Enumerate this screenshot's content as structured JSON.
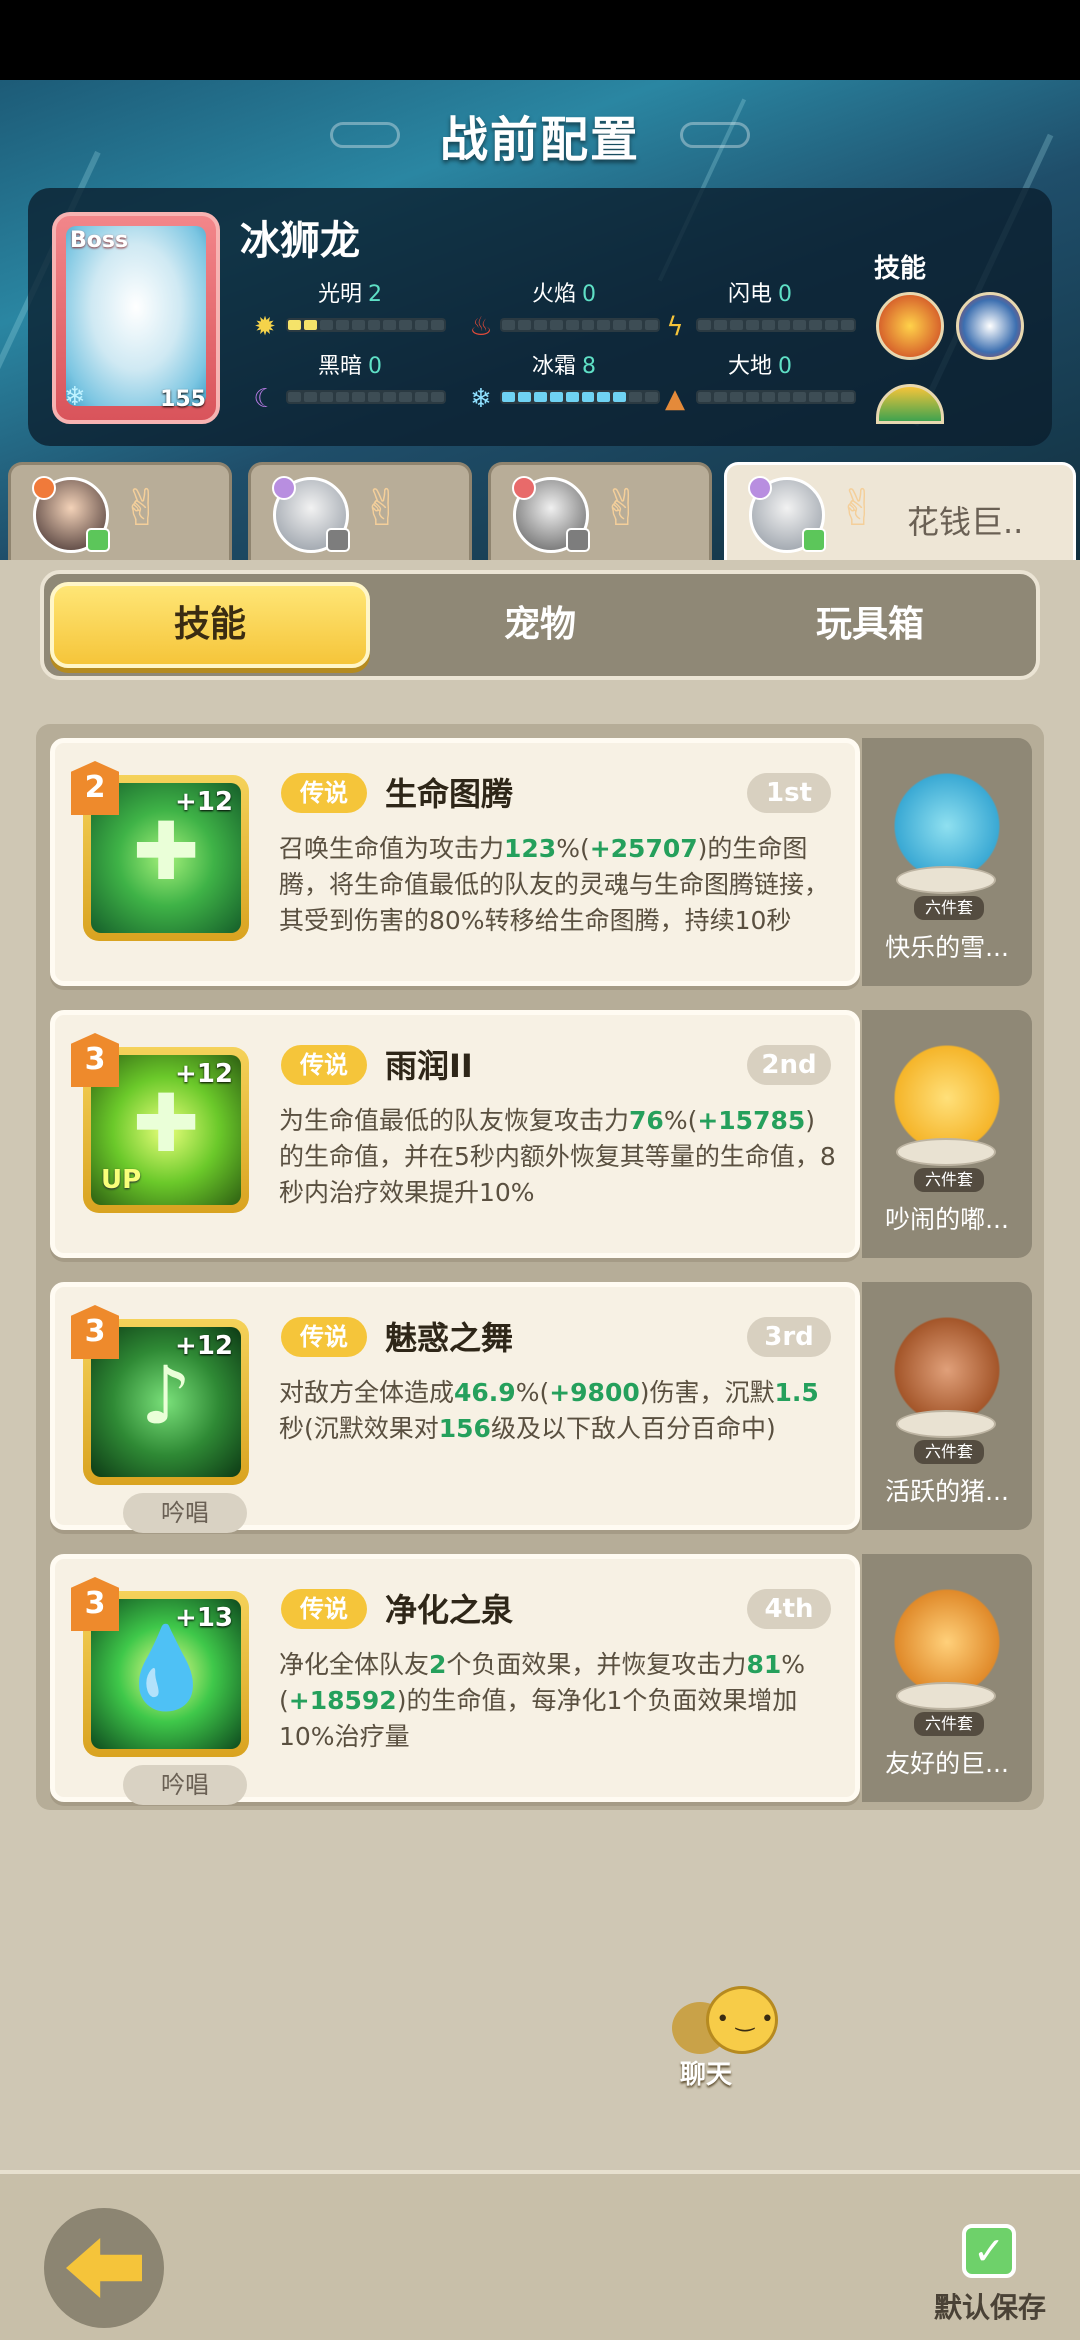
{
  "header": {
    "title": "战前配置"
  },
  "boss": {
    "tag": "Boss",
    "level": "155",
    "name": "冰狮龙",
    "skills_label": "技能",
    "elements": [
      {
        "name": "光明",
        "value": "2",
        "level": 2
      },
      {
        "name": "火焰",
        "value": "0",
        "level": 0
      },
      {
        "name": "闪电",
        "value": "0",
        "level": 0
      },
      {
        "name": "黑暗",
        "value": "0",
        "level": 0
      },
      {
        "name": "冰霜",
        "value": "8",
        "level": 8
      },
      {
        "name": "大地",
        "value": "0",
        "level": 0
      }
    ]
  },
  "hero_tabs": [
    {
      "label": ""
    },
    {
      "label": ""
    },
    {
      "label": ""
    },
    {
      "label": "花钱巨.."
    }
  ],
  "segments": {
    "skills": "技能",
    "pets": "宠物",
    "toybox": "玩具箱"
  },
  "skills": [
    {
      "rank": "2",
      "plus": "+12",
      "rarity": "传说",
      "title": "生命图腾",
      "order": "1st",
      "desc": {
        "p1": "召唤生命值为攻击力",
        "v1": "123",
        "p2": "%(",
        "v2": "+25707",
        "p3": ")的生命图腾，将生命值最低的队友的灵魂与生命图腾链接，其受到伤害的80%转移给生命图腾，持续10秒"
      },
      "chant": "",
      "pet": {
        "set": "六件套",
        "name": "快乐的雪..."
      }
    },
    {
      "rank": "3",
      "plus": "+12",
      "up": "UP",
      "rarity": "传说",
      "title": "雨润II",
      "order": "2nd",
      "desc": {
        "p1": "为生命值最低的队友恢复攻击力",
        "v1": "76",
        "p2": "%(",
        "v2": "+15785",
        "p3": ")的生命值，并在5秒内额外恢复其等量的生命值，8秒内治疗效果提升10%"
      },
      "chant": "",
      "pet": {
        "set": "六件套",
        "name": "吵闹的嘟..."
      }
    },
    {
      "rank": "3",
      "plus": "+12",
      "rarity": "传说",
      "title": "魅惑之舞",
      "order": "3rd",
      "desc": {
        "p1": "对敌方全体造成",
        "v1": "46.9",
        "p2": "%(",
        "v2": "+9800",
        "p3": ")伤害，沉默",
        "v3": "1.5",
        "p4": "秒(沉默效果对",
        "v4": "156",
        "p5": "级及以下敌人百分百命中)"
      },
      "chant": "吟唱",
      "pet": {
        "set": "六件套",
        "name": "活跃的猪..."
      }
    },
    {
      "rank": "3",
      "plus": "+13",
      "rarity": "传说",
      "title": "净化之泉",
      "order": "4th",
      "desc": {
        "p1": "净化全体队友",
        "v1": "2",
        "p2": "个负面效果，并恢复攻击力",
        "v2": "81",
        "p3": "%(",
        "v3": "+18592",
        "p4": ")的生命值，每净化1个负面效果增加10%治疗量"
      },
      "chant": "吟唱",
      "pet": {
        "set": "六件套",
        "name": "友好的巨..."
      }
    }
  ],
  "chat": {
    "label": "聊天"
  },
  "footer": {
    "save_label": "默认保存"
  },
  "colors": {
    "accent": "#f5c53a",
    "highlight": "#25a05c",
    "panel": "#cfc7b4"
  }
}
